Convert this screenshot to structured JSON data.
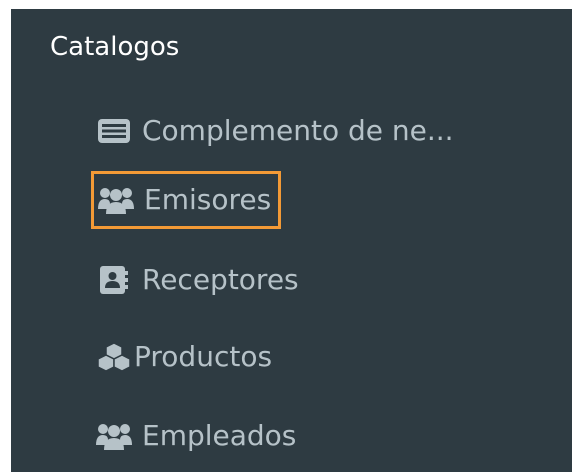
{
  "sidebar": {
    "section_title": "Catalogos",
    "items": [
      {
        "label": "Complemento de ne...",
        "icon": "list-card-icon"
      },
      {
        "label": "Emisores",
        "icon": "users-icon",
        "highlighted": true,
        "highlight_color": "#f39a36"
      },
      {
        "label": "Receptores",
        "icon": "address-book-icon"
      },
      {
        "label": "Productos",
        "icon": "cubes-icon"
      },
      {
        "label": "Empleados",
        "icon": "users-icon"
      }
    ]
  },
  "colors": {
    "panel_bg": "#2e3b42",
    "title_text": "#ffffff",
    "item_text": "#b6c2c8",
    "highlight": "#f39a36"
  }
}
